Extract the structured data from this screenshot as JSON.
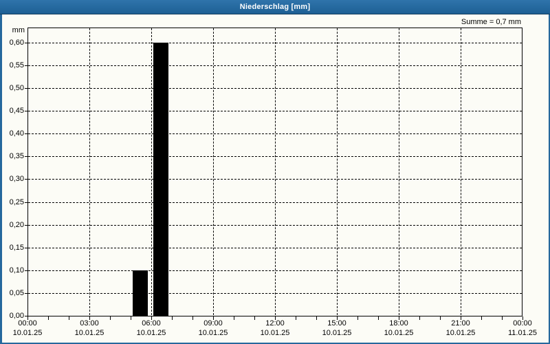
{
  "window": {
    "title": "Niederschlag [mm]"
  },
  "header": {
    "sum_label": "Summe = 0,7 mm"
  },
  "colors": {
    "titlebar": "#24689e",
    "window_border": "#26689d",
    "background": "#fcfcf6",
    "bar": "#000000",
    "grid": "#000000",
    "title_text": "#ffffff"
  },
  "chart_data": {
    "type": "bar",
    "title": "Niederschlag [mm]",
    "xlabel": "",
    "ylabel": "mm",
    "ylim": [
      0,
      0.633
    ],
    "x_total_hours": 24,
    "grid": {
      "horizontal_dashed": true,
      "vertical_dashed_at_major_ticks": true
    },
    "legend": "none",
    "sum_mm": 0.7,
    "y_ticks": [
      {
        "value": 0.0,
        "label": "0,00"
      },
      {
        "value": 0.05,
        "label": "0,05"
      },
      {
        "value": 0.1,
        "label": "0,10"
      },
      {
        "value": 0.15,
        "label": "0,15"
      },
      {
        "value": 0.2,
        "label": "0,20"
      },
      {
        "value": 0.25,
        "label": "0,25"
      },
      {
        "value": 0.3,
        "label": "0,30"
      },
      {
        "value": 0.35,
        "label": "0,35"
      },
      {
        "value": 0.4,
        "label": "0,40"
      },
      {
        "value": 0.45,
        "label": "0,45"
      },
      {
        "value": 0.5,
        "label": "0,50"
      },
      {
        "value": 0.55,
        "label": "0,55"
      },
      {
        "value": 0.6,
        "label": "0,60"
      }
    ],
    "x_major_ticks": [
      {
        "hour": 0,
        "time": "00:00",
        "date": "10.01.25"
      },
      {
        "hour": 3,
        "time": "03:00",
        "date": "10.01.25"
      },
      {
        "hour": 6,
        "time": "06:00",
        "date": "10.01.25"
      },
      {
        "hour": 9,
        "time": "09:00",
        "date": "10.01.25"
      },
      {
        "hour": 12,
        "time": "12:00",
        "date": "10.01.25"
      },
      {
        "hour": 15,
        "time": "15:00",
        "date": "10.01.25"
      },
      {
        "hour": 18,
        "time": "18:00",
        "date": "10.01.25"
      },
      {
        "hour": 21,
        "time": "21:00",
        "date": "10.01.25"
      },
      {
        "hour": 24,
        "time": "00:00",
        "date": "11.01.25"
      }
    ],
    "x_minor_tick_every_hours": 1,
    "bars": [
      {
        "start_hour": 5,
        "end_hour": 6,
        "date": "10.01.25",
        "value": 0.1
      },
      {
        "start_hour": 6,
        "end_hour": 7,
        "date": "10.01.25",
        "value": 0.6
      }
    ]
  }
}
